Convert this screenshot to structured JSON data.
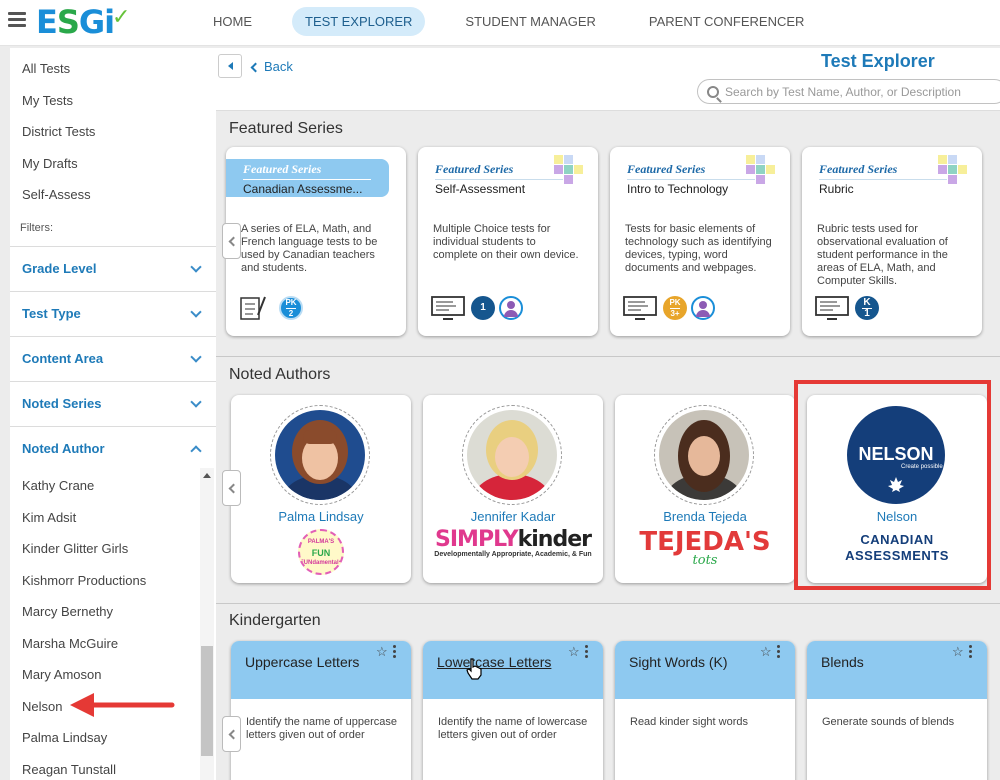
{
  "topbar": {
    "logo_text": [
      "E",
      "S",
      "G",
      "i"
    ],
    "nav": [
      {
        "label": "HOME",
        "active": false
      },
      {
        "label": "TEST EXPLORER",
        "active": true
      },
      {
        "label": "STUDENT MANAGER",
        "active": false
      },
      {
        "label": "PARENT CONFERENCER",
        "active": false
      }
    ]
  },
  "sidebar": {
    "links": [
      "All Tests",
      "My Tests",
      "District Tests",
      "My Drafts",
      "Self-Assess"
    ],
    "filters_label": "Filters:",
    "filters": [
      {
        "label": "Grade Level",
        "expanded": false
      },
      {
        "label": "Test Type",
        "expanded": false
      },
      {
        "label": "Content Area",
        "expanded": false
      },
      {
        "label": "Noted Series",
        "expanded": false
      },
      {
        "label": "Noted Author",
        "expanded": true
      }
    ],
    "authors": [
      "Kathy Crane",
      "Kim Adsit",
      "Kinder Glitter Girls",
      "Kishmorr Productions",
      "Marcy Bernethy",
      "Marsha McGuire",
      "Mary Amoson",
      "Nelson",
      "Palma Lindsay",
      "Reagan Tunstall"
    ]
  },
  "header": {
    "back_label": "Back",
    "title": "Test Explorer",
    "search_placeholder": "Search by Test Name, Author, or Description"
  },
  "sections": {
    "featured": "Featured Series",
    "authors": "Noted Authors",
    "kindergarten": "Kindergarten"
  },
  "featured_series": [
    {
      "ribbon": "Featured Series",
      "name": "Canadian Assessme...",
      "desc": "A series of ELA, Math, and French language tests to be used by Canadian teachers and students.",
      "badge": [
        "PK",
        "2"
      ]
    },
    {
      "ribbon": "Featured Series",
      "name": "Self-Assessment",
      "desc": "Multiple Choice tests for individual students to complete on their own device.",
      "badge": [
        "1"
      ]
    },
    {
      "ribbon": "Featured Series",
      "name": "Intro to Technology",
      "desc": "Tests for basic elements of technology such as identifying devices, typing, word documents and webpages.",
      "badge": [
        "PK",
        "3+"
      ]
    },
    {
      "ribbon": "Featured Series",
      "name": "Rubric",
      "desc": "Rubric tests used for observational evaluation of student performance in the areas of ELA, Math, and Computer Skills.",
      "badge": [
        "K",
        "1"
      ]
    }
  ],
  "noted_authors": [
    {
      "name": "Palma Lindsay",
      "logo": [
        "PALMA'S",
        "FUN",
        "FUNdamentals"
      ]
    },
    {
      "name": "Jennifer Kadar",
      "logo": [
        "SIMPLY",
        "kinder",
        "Developmentally Appropriate, Academic, & Fun"
      ]
    },
    {
      "name": "Brenda Tejeda",
      "logo": [
        "TEJEDA'S",
        "tots"
      ]
    },
    {
      "name": "Nelson",
      "logo": [
        "NELSON",
        "Create possible",
        "CANADIAN",
        "ASSESSMENTS"
      ]
    }
  ],
  "kindergarten_tests": [
    {
      "name": "Uppercase Letters",
      "desc": "Identify the name of uppercase letters given out of order"
    },
    {
      "name": "Lowercase Letters",
      "desc": "Identify the name of lowercase letters given out of order"
    },
    {
      "name": "Sight Words (K)",
      "desc": "Read kinder sight words"
    },
    {
      "name": "Blends",
      "desc": "Generate sounds of blends"
    }
  ],
  "icons": {
    "star": "☆"
  },
  "colors": {
    "brand_blue": "#1e7ab8",
    "accent_light": "#8ec9f0",
    "highlight_red": "#e53935",
    "nelson_navy": "#143e7a"
  }
}
